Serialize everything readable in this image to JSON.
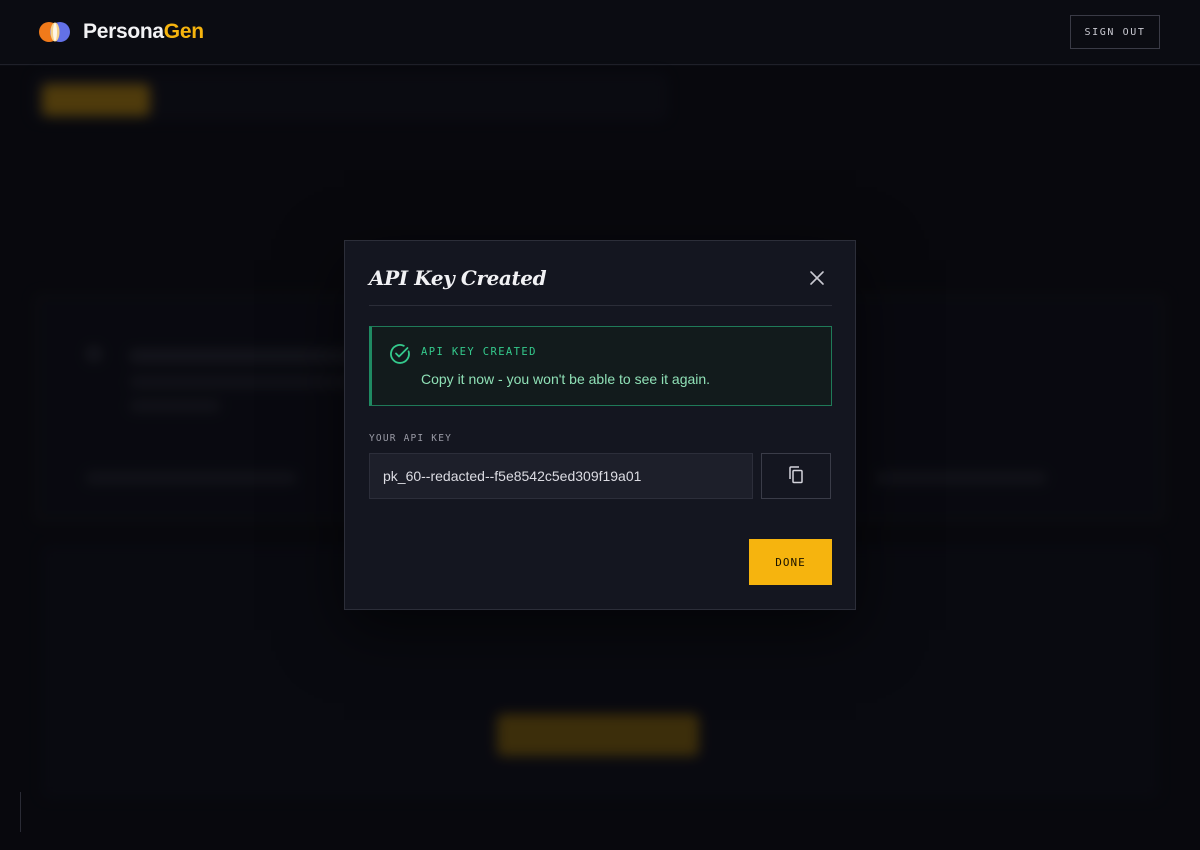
{
  "app": {
    "name_part1": "Persona",
    "name_part2": "Gen",
    "colors": {
      "accent": "#f6b40e",
      "success": "#34c98c",
      "background": "#0b0c12"
    }
  },
  "header": {
    "sign_out_label": "SIGN OUT"
  },
  "modal": {
    "title": "API Key Created",
    "close_icon": "close-icon",
    "alert": {
      "icon": "check-circle-icon",
      "heading": "API KEY CREATED",
      "message": "Copy it now - you won't be able to see it again."
    },
    "key_label": "YOUR API KEY",
    "key_value": "pk_60--redacted--f5e8542c5ed309f19a01",
    "copy_icon": "copy-icon",
    "done_label": "DONE"
  }
}
